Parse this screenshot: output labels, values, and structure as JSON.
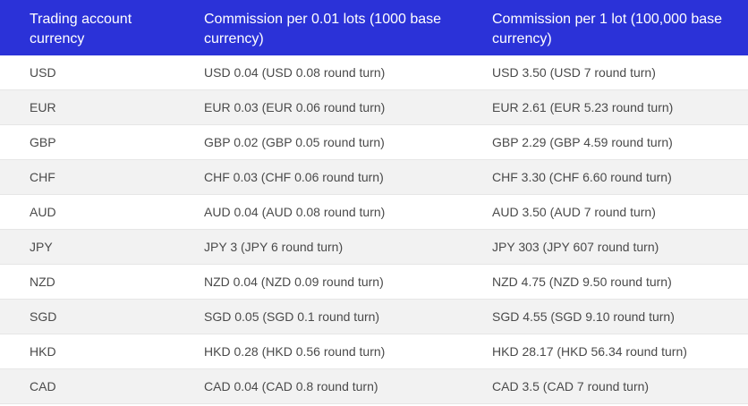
{
  "headers": {
    "col1": "Trading account currency",
    "col2": "Commission per 0.01 lots (1000 base currency)",
    "col3": "Commission per 1 lot (100,000 base currency)"
  },
  "rows": [
    {
      "currency": "USD",
      "per_001": "USD 0.04 (USD 0.08 round turn)",
      "per_1": "USD 3.50 (USD 7 round turn)"
    },
    {
      "currency": "EUR",
      "per_001": "EUR 0.03 (EUR 0.06 round turn)",
      "per_1": "EUR 2.61 (EUR 5.23 round turn)"
    },
    {
      "currency": "GBP",
      "per_001": "GBP 0.02 (GBP 0.05 round turn)",
      "per_1": "GBP 2.29 (GBP 4.59 round turn)"
    },
    {
      "currency": "CHF",
      "per_001": "CHF 0.03 (CHF 0.06 round turn)",
      "per_1": "CHF 3.30 (CHF 6.60 round turn)"
    },
    {
      "currency": "AUD",
      "per_001": "AUD 0.04 (AUD 0.08 round turn)",
      "per_1": "AUD 3.50 (AUD 7 round turn)"
    },
    {
      "currency": "JPY",
      "per_001": "JPY 3 (JPY 6 round turn)",
      "per_1": "JPY 303 (JPY 607 round turn)"
    },
    {
      "currency": "NZD",
      "per_001": "NZD 0.04 (NZD 0.09 round turn)",
      "per_1": "NZD 4.75 (NZD 9.50 round turn)"
    },
    {
      "currency": "SGD",
      "per_001": "SGD 0.05 (SGD 0.1 round turn)",
      "per_1": "SGD 4.55 (SGD 9.10 round turn)"
    },
    {
      "currency": "HKD",
      "per_001": "HKD 0.28 (HKD 0.56 round turn)",
      "per_1": "HKD 28.17 (HKD 56.34 round turn)"
    },
    {
      "currency": "CAD",
      "per_001": "CAD 0.04 (CAD 0.8 round turn)",
      "per_1": "CAD 3.5 (CAD 7 round turn)"
    }
  ],
  "colors": {
    "header_bg": "#2b32d8",
    "header_text": "#ffffff",
    "body_text": "#4a4a4a",
    "stripe": "#f2f2f2"
  }
}
